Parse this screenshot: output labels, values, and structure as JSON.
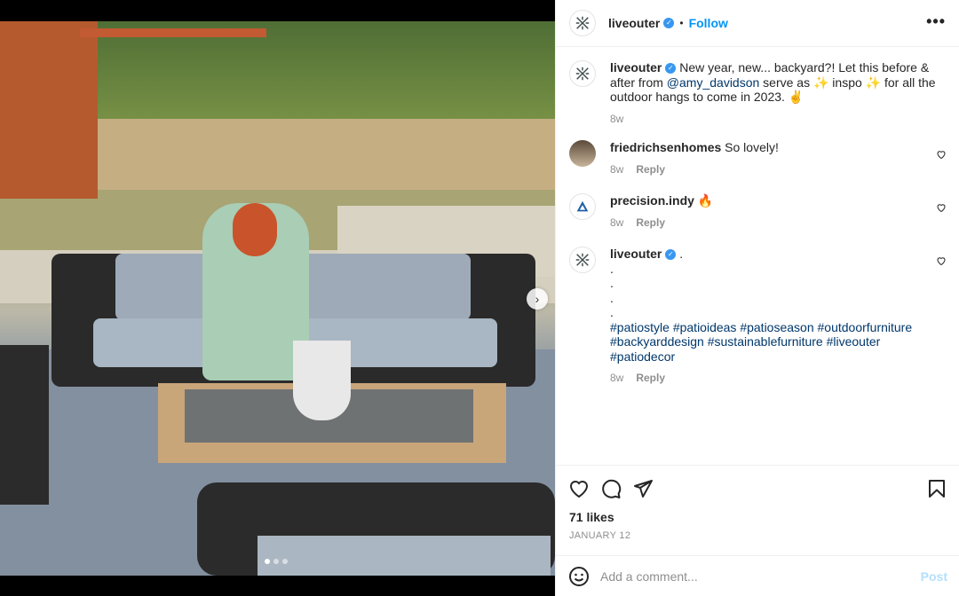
{
  "post": {
    "author": "liveouter",
    "follow_label": "Follow",
    "separator": "•",
    "more_label": "•••"
  },
  "caption": {
    "username": "liveouter",
    "text_before": "New year, new... backyard?! Let this before & after from ",
    "mention": "@amy_davidson",
    "text_after": " serve as ✨ inspo ✨ for all the outdoor hangs to come in 2023. ✌️",
    "time": "8w"
  },
  "comments": [
    {
      "username": "friedrichsenhomes",
      "text": "So lovely!",
      "time": "8w",
      "reply": "Reply"
    },
    {
      "username": "precision.indy",
      "text": "🔥",
      "time": "8w",
      "reply": "Reply"
    },
    {
      "username": "liveouter",
      "text": ".",
      "dots": [
        ".",
        ".",
        ".",
        "."
      ],
      "hashtags": "#patiostyle #patioideas #patioseason #outdoorfurniture #backyarddesign #sustainablefurniture #liveouter #patiodecor",
      "time": "8w",
      "reply": "Reply"
    }
  ],
  "likes": "71 likes",
  "date": "JANUARY 12",
  "add_comment": {
    "placeholder": "Add a comment...",
    "post_label": "Post"
  },
  "carousel": {
    "slides": 3,
    "active": 1
  },
  "colors": {
    "accent": "#0095f6",
    "muted": "#8e8e8e",
    "link": "#00376b"
  },
  "icons": [
    "liveouter-logo-icon",
    "verified-icon",
    "heart-icon",
    "comment-icon",
    "share-icon",
    "bookmark-icon",
    "emoji-icon",
    "chevron-right-icon"
  ]
}
